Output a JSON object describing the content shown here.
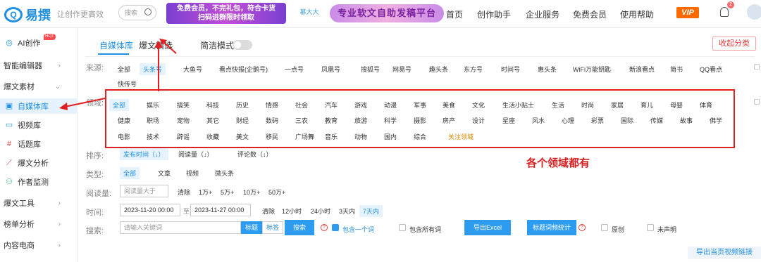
{
  "topbar": {
    "logo_text": "易撰",
    "slogan": "让创作更高效",
    "search_placeholder": "搜索",
    "banner1_line1": "免费会员，不完礼包，符合卡货",
    "banner1_line2": "扫码进群限时领取",
    "banner2_logo": "慕大大",
    "banner2_text": "专业软文自助发稿平台",
    "nav": [
      "首页",
      "创作助手",
      "企业服务",
      "免费会员",
      "使用帮助"
    ],
    "vip": "VIP",
    "notif_count": "2"
  },
  "sidebar": {
    "items": [
      {
        "label": "AI创作",
        "badge": "HOT"
      },
      {
        "label": "智能编辑器"
      },
      {
        "label": "爆文素材"
      },
      {
        "label": "自媒体库"
      },
      {
        "label": "视频库"
      },
      {
        "label": "话题库"
      },
      {
        "label": "爆文分析"
      },
      {
        "label": "作者监测"
      },
      {
        "label": "爆文工具"
      },
      {
        "label": "榜单分析"
      },
      {
        "label": "内容电商"
      }
    ]
  },
  "tabs": {
    "t1": "自媒体库",
    "t2": "爆文精选",
    "simple_mode": "简洁模式",
    "collapse": "收起分类"
  },
  "source": {
    "label": "来源:",
    "items": [
      "全部",
      "头条号",
      "大鱼号",
      "看点快报(企鹅号)",
      "一点号",
      "凤凰号",
      "搜狐号",
      "网易号",
      "趣头条",
      "东方号",
      "时间号",
      "惠头条",
      "WiFi万能钥匙",
      "新浪看点",
      "简书",
      "QQ看点",
      "快传号"
    ]
  },
  "domain": {
    "label": "领域:",
    "row1": [
      "全部",
      "娱乐",
      "搞笑",
      "科技",
      "历史",
      "情感",
      "社会",
      "汽车",
      "游戏",
      "动漫",
      "军事",
      "美食",
      "文化",
      "生活小贴士",
      "生活",
      "时尚",
      "家居",
      "育儿",
      "母婴",
      "体育"
    ],
    "row2": [
      "健康",
      "职场",
      "宠物",
      "其它",
      "财经",
      "数码",
      "三农",
      "教育",
      "旅游",
      "科学",
      "摄影",
      "房产",
      "设计",
      "星座",
      "风水",
      "心理",
      "彩票",
      "国际",
      "传媒",
      "故事",
      "佛学"
    ],
    "row3": [
      "电影",
      "技术",
      "辟谣",
      "收藏",
      "美文",
      "移民",
      "广场舞",
      "音乐",
      "动物",
      "国内",
      "综合"
    ],
    "follow": "关注领域"
  },
  "annotation": "各个领域都有",
  "sort": {
    "label": "排序:",
    "items": [
      "发布时间（↓）",
      "阅读量（↓）",
      "评论数（↓）"
    ]
  },
  "type": {
    "label": "类型:",
    "items": [
      "全部",
      "文章",
      "视频",
      "微头条"
    ]
  },
  "reads": {
    "label": "阅读量:",
    "placeholder": "阅读量大于",
    "items": [
      "清除",
      "1万+",
      "5万+",
      "10万+",
      "50万+"
    ]
  },
  "time": {
    "label": "时间:",
    "start": "2023-11-20 00:00",
    "separator": "至",
    "end": "2023-11-27 00:00",
    "items": [
      "清除",
      "12小时",
      "24小时",
      "3天内",
      "7天内"
    ]
  },
  "search": {
    "label": "搜索:",
    "placeholder": "请输入关键词",
    "mode_title": "标题",
    "mode_body": "标签",
    "button": "搜索",
    "opt_one": "包含一个词",
    "opt_all": "包含所有词",
    "export": "导出Excel",
    "keyword_stats": "标题词频统计",
    "original": "原创",
    "undeclared": "未声明"
  },
  "export_link": "导出当页视频链接",
  "colors": {
    "accent": "#1e8fe1",
    "annotation": "#e02020"
  }
}
